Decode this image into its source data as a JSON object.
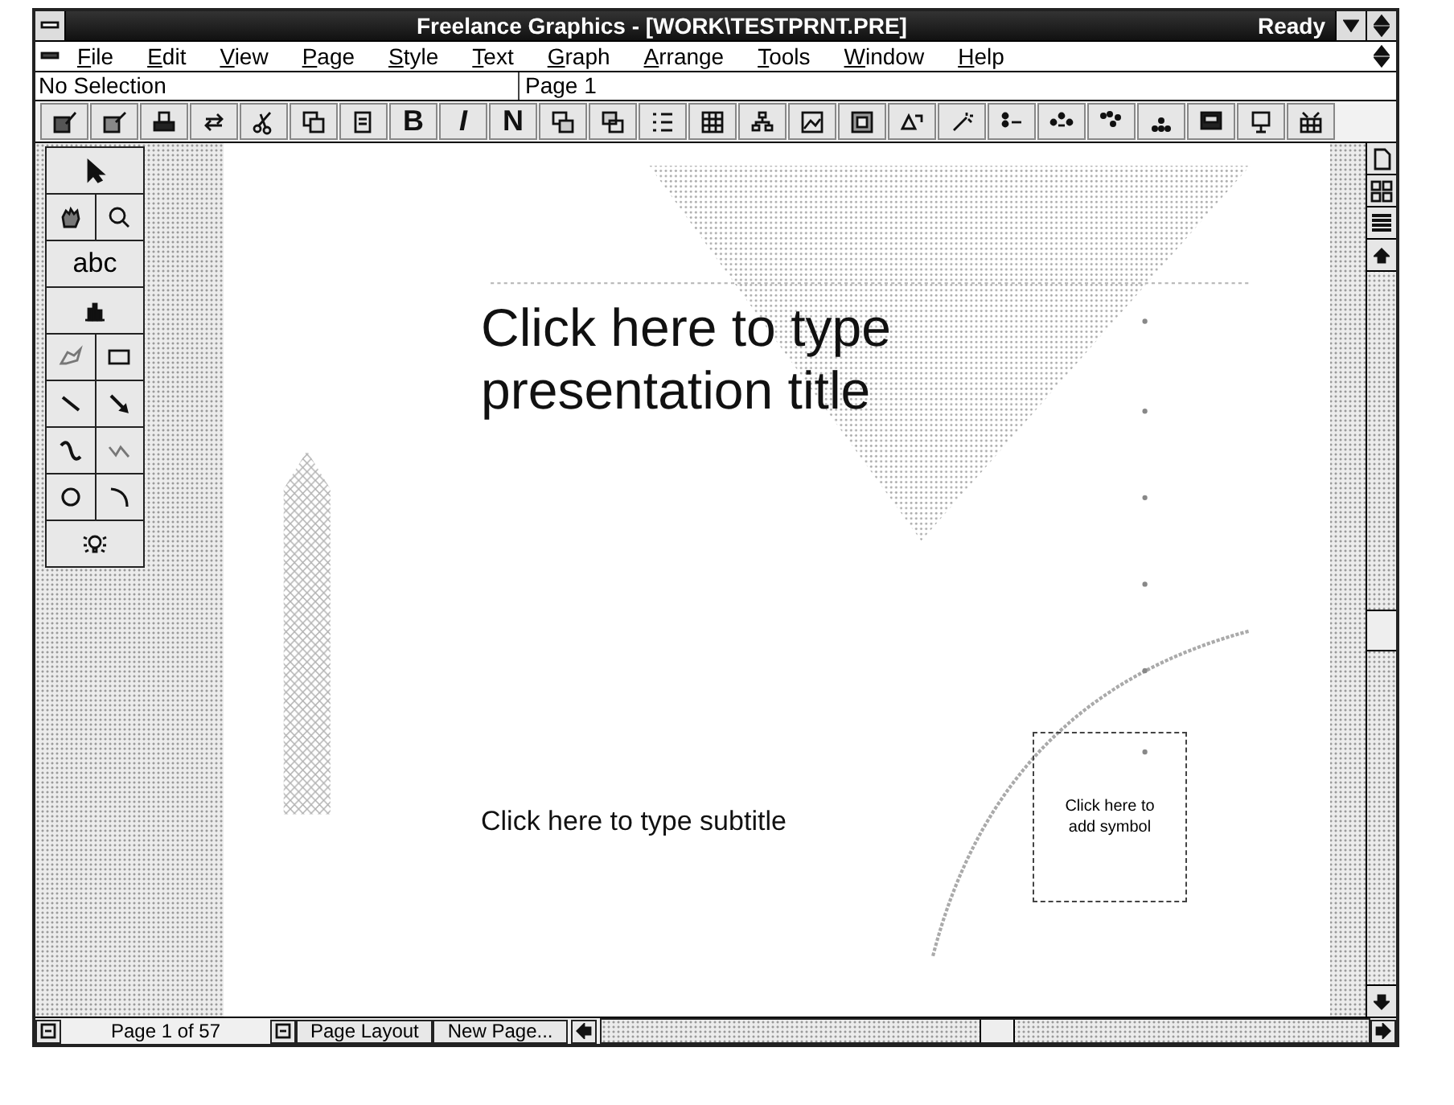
{
  "window": {
    "title": "Freelance Graphics - [WORK\\TESTPRNT.PRE]",
    "status": "Ready"
  },
  "menu": [
    "File",
    "Edit",
    "View",
    "Page",
    "Style",
    "Text",
    "Graph",
    "Arrange",
    "Tools",
    "Window",
    "Help"
  ],
  "selection_bar": {
    "selection": "No Selection",
    "page": "Page 1"
  },
  "toolbar": [
    {
      "kind": "icon"
    },
    {
      "kind": "icon"
    },
    {
      "kind": "icon"
    },
    {
      "kind": "icon"
    },
    {
      "kind": "icon"
    },
    {
      "kind": "icon"
    },
    {
      "kind": "icon"
    },
    {
      "kind": "glyph",
      "label": "B"
    },
    {
      "kind": "glyph",
      "label": "I"
    },
    {
      "kind": "glyph",
      "label": "N"
    },
    {
      "kind": "icon"
    },
    {
      "kind": "icon"
    },
    {
      "kind": "icon"
    },
    {
      "kind": "icon"
    },
    {
      "kind": "icon"
    },
    {
      "kind": "icon"
    },
    {
      "kind": "icon"
    },
    {
      "kind": "icon"
    },
    {
      "kind": "icon"
    },
    {
      "kind": "icon"
    },
    {
      "kind": "icon"
    },
    {
      "kind": "icon"
    },
    {
      "kind": "icon"
    },
    {
      "kind": "icon"
    },
    {
      "kind": "icon"
    },
    {
      "kind": "icon"
    }
  ],
  "toolbox": {
    "text_tool": "abc"
  },
  "slide": {
    "title_placeholder": "Click here to type presentation title",
    "subtitle_placeholder": "Click here to type subtitle",
    "symbol_placeholder": "Click here to add symbol"
  },
  "bottom_bar": {
    "page_indicator": "Page 1 of 57",
    "buttons": [
      "Page Layout",
      "New Page..."
    ]
  }
}
